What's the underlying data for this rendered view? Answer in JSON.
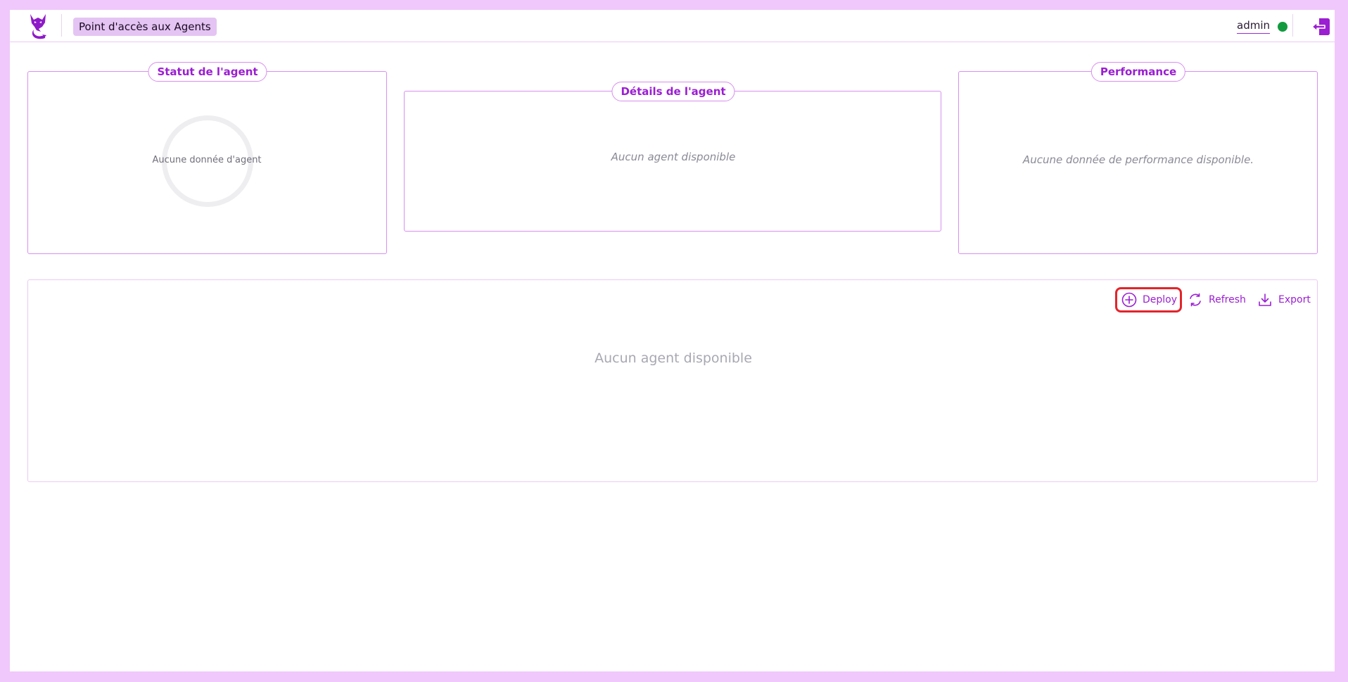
{
  "header": {
    "nav_label": "Point d'accès aux Agents",
    "user_name": "admin",
    "status_color": "#129a3f",
    "accent_color": "#9b1ed2"
  },
  "cards": {
    "status": {
      "title": "Statut de l'agent",
      "empty_text": "Aucune donnée d'agent"
    },
    "details": {
      "title": "Détails de l'agent",
      "empty_text": "Aucun agent disponible"
    },
    "performance": {
      "title": "Performance",
      "empty_text": "Aucune donnée de performance disponible."
    }
  },
  "toolbar": {
    "deploy_label": "Deploy",
    "refresh_label": "Refresh",
    "export_label": "Export"
  },
  "agents_panel": {
    "empty_text": "Aucun agent disponible"
  },
  "icons": {
    "logo": "fox-logo-icon",
    "logout": "logout-icon",
    "deploy": "plus-circle-icon",
    "refresh": "refresh-icon",
    "export": "download-icon"
  }
}
